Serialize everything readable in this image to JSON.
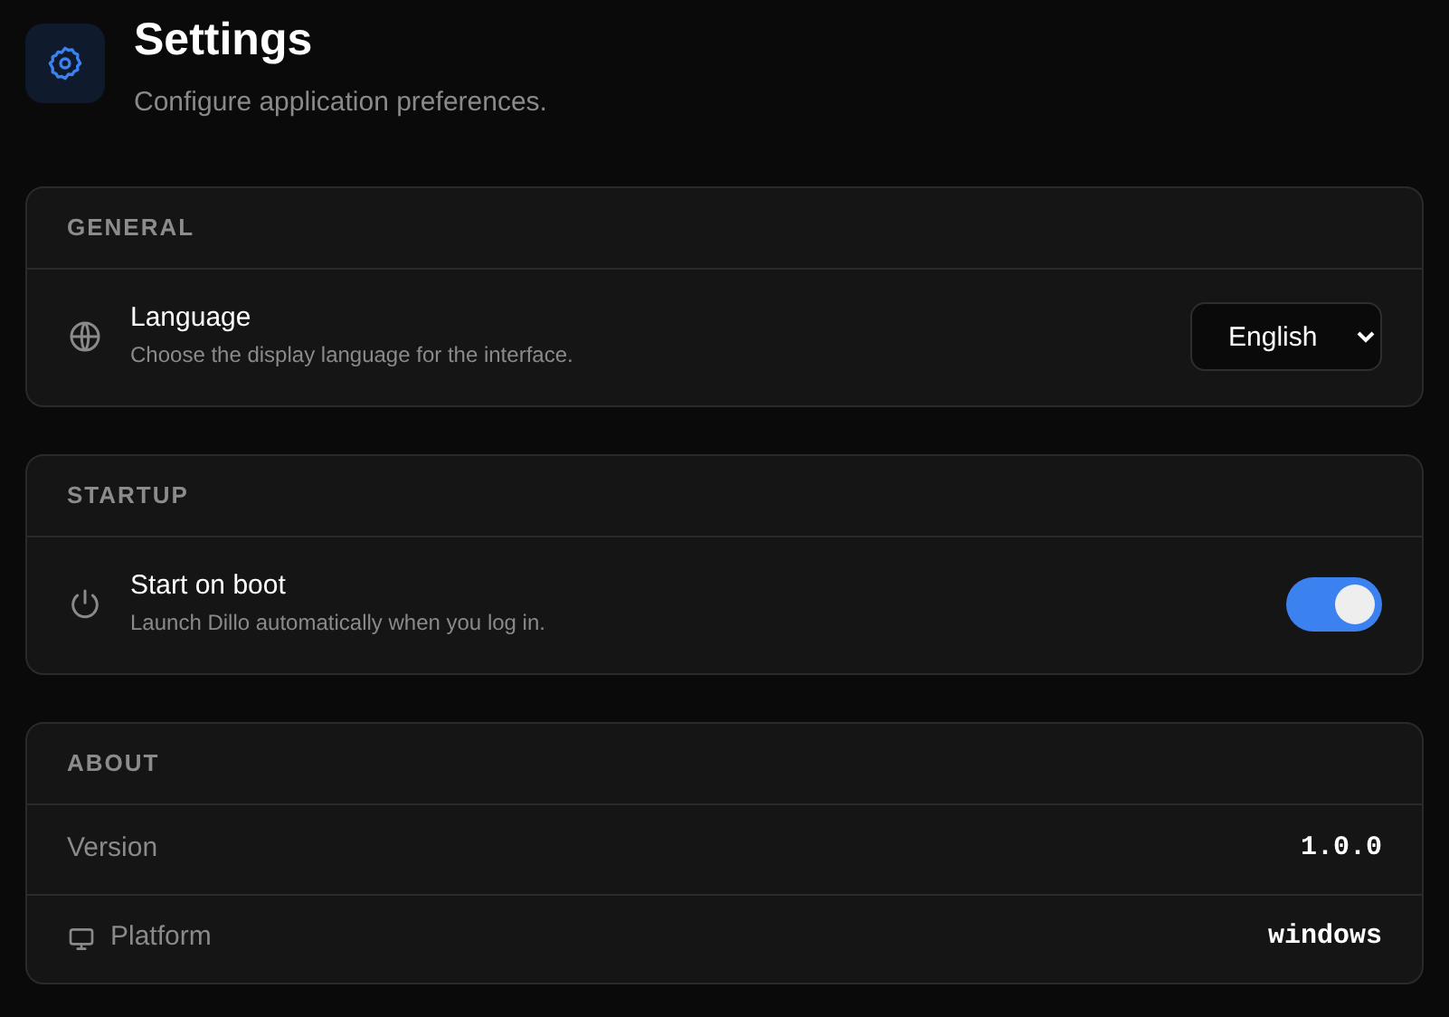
{
  "header": {
    "title": "Settings",
    "subtitle": "Configure application preferences."
  },
  "sections": [
    {
      "heading": "GENERAL",
      "rows": [
        {
          "kind": "select",
          "label": "Language",
          "description": "Choose the display language for the interface.",
          "value": "English"
        }
      ]
    },
    {
      "heading": "STARTUP",
      "rows": [
        {
          "kind": "toggle",
          "label": "Start on boot",
          "description": "Launch Dillo automatically when you log in.",
          "on": true
        }
      ]
    },
    {
      "heading": "ABOUT",
      "rows": [
        {
          "kind": "info",
          "label": "Version",
          "value": "1.0.0",
          "icon": false
        },
        {
          "kind": "info",
          "label": "Platform",
          "value": "windows",
          "icon": true
        }
      ]
    }
  ]
}
